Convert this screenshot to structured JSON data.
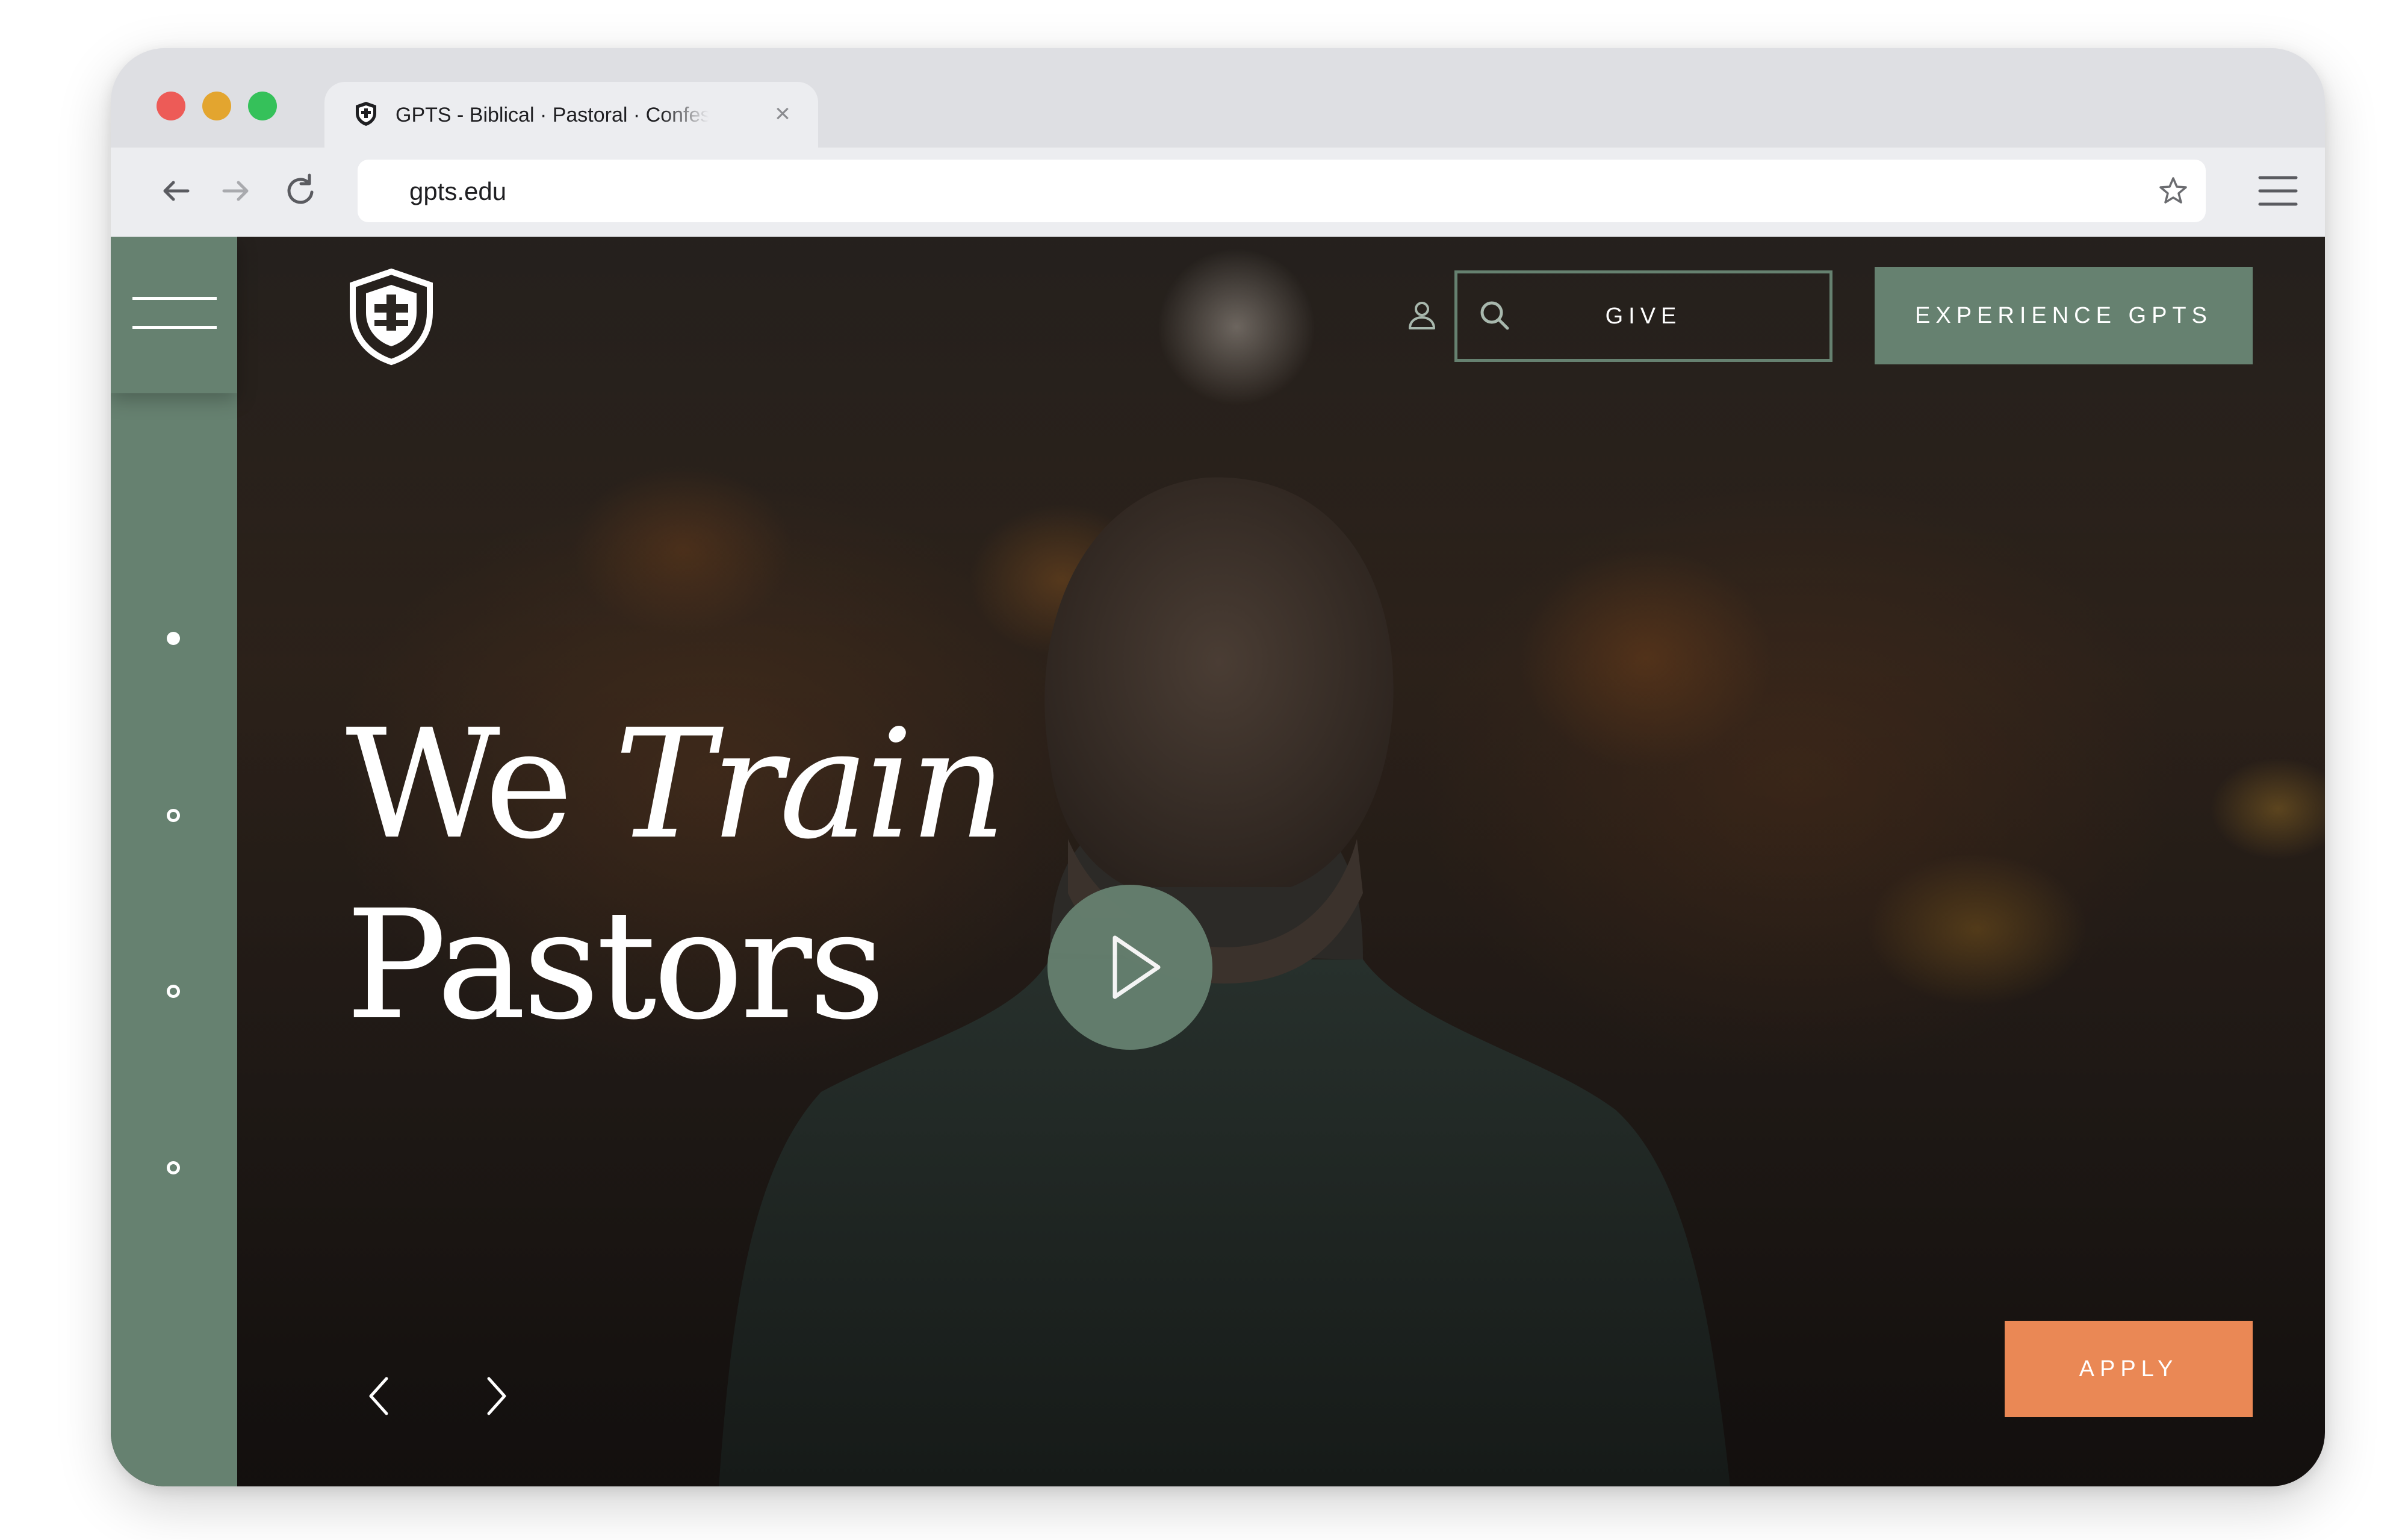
{
  "browser": {
    "tab_title": "GPTS - Biblical · Pastoral · Confessional",
    "close_glyph": "×",
    "url": "gpts.edu",
    "icons": [
      "back-arrow-icon",
      "forward-arrow-icon",
      "reload-icon",
      "bookmark-star-icon",
      "browser-menu-icon"
    ]
  },
  "header": {
    "give_label": "GIVE",
    "experience_label": "EXPERIENCE GPTS"
  },
  "hero": {
    "line1_word1": "We",
    "line1_word2": "Train",
    "line2": "Pastors",
    "apply_label": "APPLY",
    "slide_count": 4,
    "active_slide": 1
  },
  "colors": {
    "brand_green": "#668170",
    "apply_orange": "#ea8855",
    "tab_strip": "#dedfe3"
  }
}
